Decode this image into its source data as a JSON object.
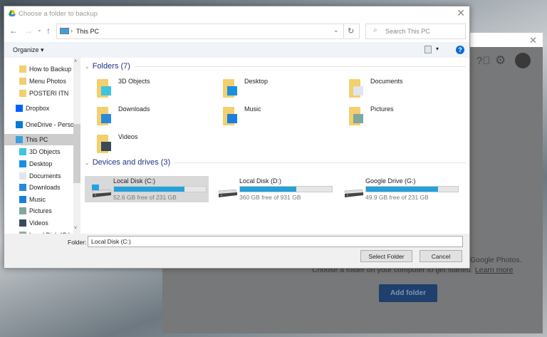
{
  "background_window": {
    "help_icon": "help-circle-icon",
    "settings_icon": "gear-icon",
    "text_line1": "Google Photos.",
    "text_line2": "Choose a folder on your computer to get started.",
    "learn_more": "Learn more",
    "add_folder": "Add folder"
  },
  "dialog": {
    "title": "Choose a folder to backup",
    "address": "This PC",
    "search_placeholder": "Search This PC",
    "organize": "Organize ▾",
    "sidebar": [
      {
        "label": "How to Backup t",
        "icon": "folder-icon"
      },
      {
        "label": "Menu Photos",
        "icon": "folder-icon"
      },
      {
        "label": "POSTERI ITN",
        "icon": "folder-icon"
      },
      {
        "label": "Dropbox",
        "icon": "dropbox-icon"
      },
      {
        "label": "OneDrive - Person",
        "icon": "onedrive-icon"
      },
      {
        "label": "This PC",
        "icon": "pc-icon",
        "selected": true
      },
      {
        "label": "3D Objects",
        "icon": "cube-icon"
      },
      {
        "label": "Desktop",
        "icon": "desktop-icon"
      },
      {
        "label": "Documents",
        "icon": "document-icon"
      },
      {
        "label": "Downloads",
        "icon": "download-icon"
      },
      {
        "label": "Music",
        "icon": "music-icon"
      },
      {
        "label": "Pictures",
        "icon": "picture-icon"
      },
      {
        "label": "Videos",
        "icon": "video-icon"
      },
      {
        "label": "Local Disk (C:)",
        "icon": "drive-icon"
      }
    ],
    "folders_header": "Folders (7)",
    "folders": [
      {
        "label": "3D Objects",
        "icon": "cube-icon"
      },
      {
        "label": "Desktop",
        "icon": "desktop-icon"
      },
      {
        "label": "Documents",
        "icon": "document-icon"
      },
      {
        "label": "Downloads",
        "icon": "download-icon"
      },
      {
        "label": "Music",
        "icon": "music-icon"
      },
      {
        "label": "Pictures",
        "icon": "picture-icon"
      },
      {
        "label": "Videos",
        "icon": "video-icon"
      }
    ],
    "drives_header": "Devices and drives (3)",
    "drives": [
      {
        "name": "Local Disk (C:)",
        "free": "52.6 GB free of 231 GB",
        "used_percent": 77,
        "selected": true
      },
      {
        "name": "Local Disk (D:)",
        "free": "360 GB free of 931 GB",
        "used_percent": 61
      },
      {
        "name": "Google Drive (G:)",
        "free": "49.9 GB free of 231 GB",
        "used_percent": 78
      }
    ],
    "folder_label": "Folder:",
    "folder_value": "Local Disk (C:)",
    "select_button": "Select Folder",
    "cancel_button": "Cancel",
    "accent": "#26a0da"
  }
}
